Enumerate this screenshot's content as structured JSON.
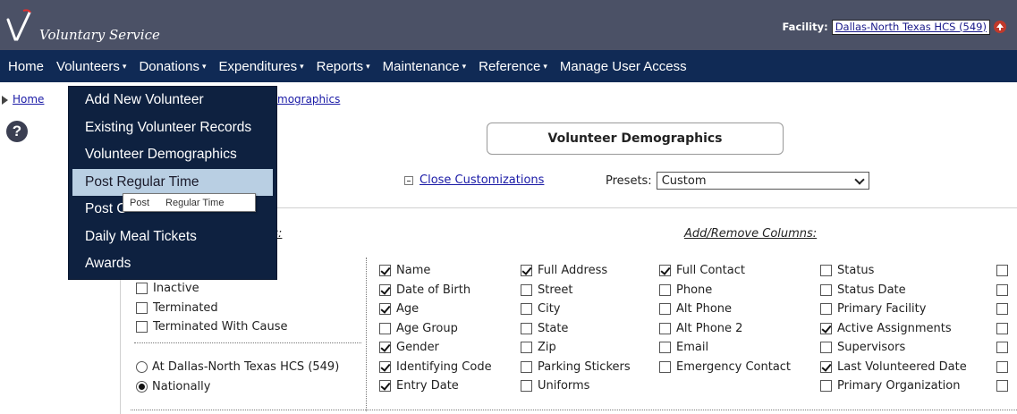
{
  "app": {
    "title": "Voluntary Service",
    "facility_label": "Facility:",
    "facility_value": "Dallas-North Texas HCS (549)"
  },
  "nav": {
    "items": [
      {
        "label": "Home",
        "dropdown": false
      },
      {
        "label": "Volunteers",
        "dropdown": true
      },
      {
        "label": "Donations",
        "dropdown": true
      },
      {
        "label": "Expenditures",
        "dropdown": true
      },
      {
        "label": "Reports",
        "dropdown": true
      },
      {
        "label": "Maintenance",
        "dropdown": true
      },
      {
        "label": "Reference",
        "dropdown": true
      },
      {
        "label": "Manage User Access",
        "dropdown": false
      }
    ]
  },
  "breadcrumb": {
    "home": "Home",
    "tail": "mographics"
  },
  "volunteers_menu": {
    "items": [
      "Add New Volunteer",
      "Existing Volunteer Records",
      "Volunteer Demographics",
      "Post Regular Time",
      "Post O",
      "Daily Meal Tickets",
      "Awards"
    ],
    "highlighted_index": 3,
    "tooltip": [
      "Post",
      "Regular Time"
    ]
  },
  "page": {
    "title": "Volunteer Demographics",
    "close_customizations": "Close Customizations",
    "presets_label": "Presets:",
    "presets_value": "Custom",
    "status_heading": "us:",
    "columns_heading": "Add/Remove Columns:"
  },
  "status_filters": [
    {
      "label": "Inactive",
      "checked": false
    },
    {
      "label": "Terminated",
      "checked": false
    },
    {
      "label": "Terminated With Cause",
      "checked": false
    }
  ],
  "scope_options": [
    {
      "label": "At Dallas-North Texas HCS (549)",
      "selected": false
    },
    {
      "label": "Nationally",
      "selected": true
    }
  ],
  "columns": [
    [
      {
        "label": "Name",
        "checked": true
      },
      {
        "label": "Date of Birth",
        "checked": true
      },
      {
        "label": "Age",
        "checked": true
      },
      {
        "label": "Age Group",
        "checked": false
      },
      {
        "label": "Gender",
        "checked": true
      },
      {
        "label": "Identifying Code",
        "checked": true
      },
      {
        "label": "Entry Date",
        "checked": true
      }
    ],
    [
      {
        "label": "Full Address",
        "checked": true
      },
      {
        "label": "Street",
        "checked": false
      },
      {
        "label": "City",
        "checked": false
      },
      {
        "label": "State",
        "checked": false
      },
      {
        "label": "Zip",
        "checked": false
      },
      {
        "label": "Parking Stickers",
        "checked": false
      },
      {
        "label": "Uniforms",
        "checked": false
      }
    ],
    [
      {
        "label": "Full Contact",
        "checked": true
      },
      {
        "label": "Phone",
        "checked": false
      },
      {
        "label": "Alt Phone",
        "checked": false
      },
      {
        "label": "Alt Phone 2",
        "checked": false
      },
      {
        "label": "Email",
        "checked": false
      },
      {
        "label": "Emergency Contact",
        "checked": false
      }
    ],
    [
      {
        "label": "Status",
        "checked": false
      },
      {
        "label": "Status Date",
        "checked": false
      },
      {
        "label": "Primary Facility",
        "checked": false
      },
      {
        "label": "Active Assignments",
        "checked": true
      },
      {
        "label": "Supervisors",
        "checked": false
      },
      {
        "label": "Last Volunteered Date",
        "checked": true
      },
      {
        "label": "Primary Organization",
        "checked": false
      }
    ],
    [
      {
        "label": "",
        "checked": false
      },
      {
        "label": "",
        "checked": false
      },
      {
        "label": "",
        "checked": false
      },
      {
        "label": "",
        "checked": false
      },
      {
        "label": "",
        "checked": false
      },
      {
        "label": "",
        "checked": false
      },
      {
        "label": "",
        "checked": false
      }
    ]
  ]
}
